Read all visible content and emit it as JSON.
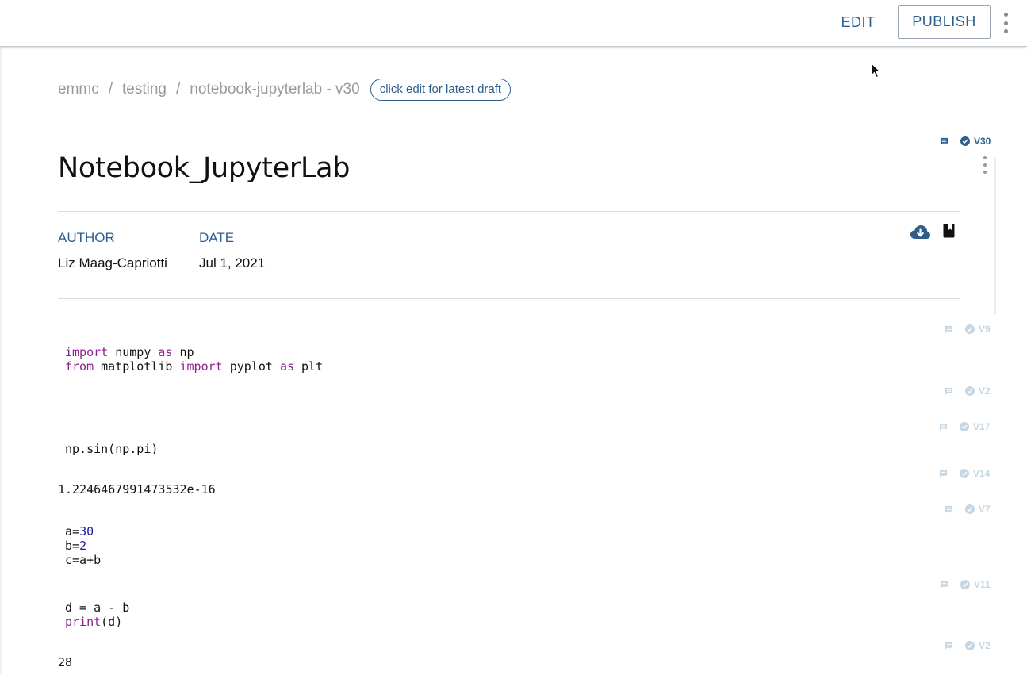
{
  "toolbar": {
    "edit_label": "EDIT",
    "publish_label": "PUBLISH"
  },
  "breadcrumb": {
    "items": [
      "emmc",
      "testing",
      "notebook-jupyterlab - v30"
    ],
    "separator": "/",
    "draft_pill": "click edit for latest draft"
  },
  "document": {
    "title": "Notebook_JupyterLab",
    "version_badge": "V30",
    "author_label": "AUTHOR",
    "author": "Liz Maag-Capriotti",
    "date_label": "DATE",
    "date": "Jul 1, 2021"
  },
  "cells": [
    {
      "version": "V9",
      "code": [
        [
          {
            "t": "import",
            "k": "kw"
          },
          {
            "t": " numpy "
          },
          {
            "t": "as",
            "k": "kw"
          },
          {
            "t": " np"
          }
        ],
        [
          {
            "t": "from",
            "k": "kw"
          },
          {
            "t": " matplotlib "
          },
          {
            "t": "import",
            "k": "kw"
          },
          {
            "t": " pyplot "
          },
          {
            "t": "as",
            "k": "kw"
          },
          {
            "t": " plt"
          }
        ]
      ]
    },
    {
      "version": "V2"
    },
    {
      "version": "V17",
      "code": [
        [
          {
            "t": "np.sin(np.pi)"
          }
        ]
      ]
    },
    {
      "version": "V14",
      "output": "1.2246467991473532e-16"
    },
    {
      "version": "V7",
      "code": [
        [
          {
            "t": "a="
          },
          {
            "t": "30",
            "k": "num"
          }
        ],
        [
          {
            "t": "b="
          },
          {
            "t": "2",
            "k": "num"
          }
        ],
        [
          {
            "t": "c=a+b"
          }
        ]
      ]
    },
    {
      "version": "V11",
      "code": [
        [
          {
            "t": "d = a - b"
          }
        ],
        [
          {
            "t": "print",
            "k": "kw"
          },
          {
            "t": "(d)"
          }
        ]
      ]
    },
    {
      "version": "V2",
      "output": "28"
    }
  ],
  "colors": {
    "accent": "#2d5e8c",
    "keyword": "#8e1f8e",
    "number": "#1a1aa6",
    "muted_tag": "#c6d6e3"
  },
  "icons": [
    "kebab-menu-icon",
    "comment-icon",
    "check-circle-icon",
    "cloud-download-icon",
    "notebook-icon",
    "mouse-cursor-icon"
  ]
}
